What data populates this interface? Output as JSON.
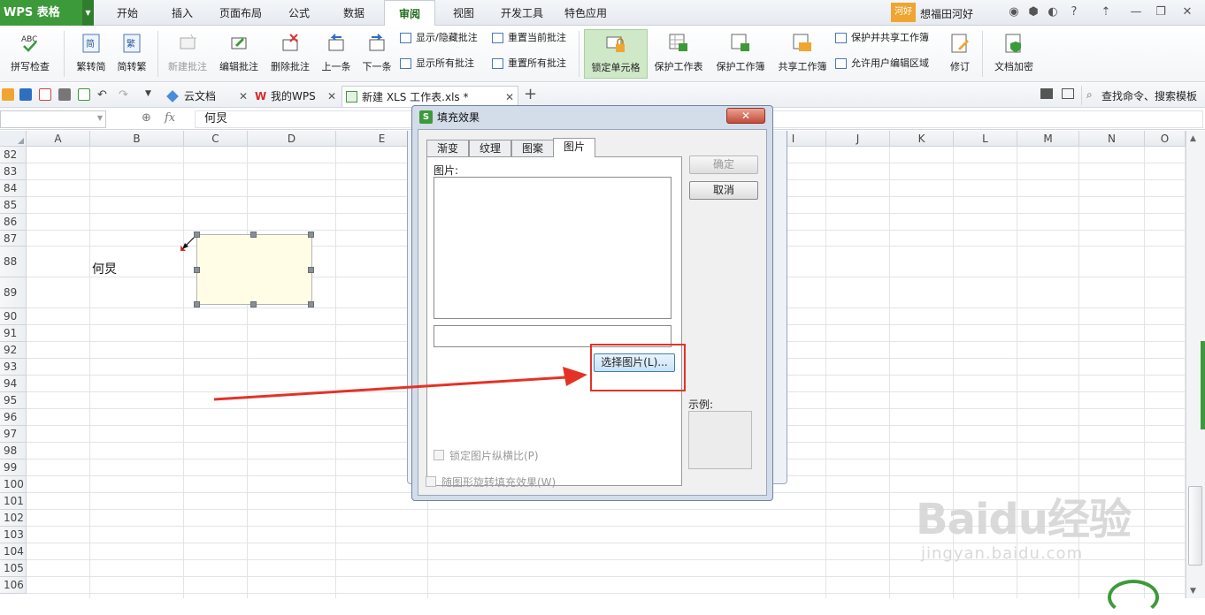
{
  "app": {
    "logo": "WPS 表格",
    "user_badge": "河好",
    "user_name": "想福田河好"
  },
  "menu": {
    "tabs": [
      "开始",
      "插入",
      "页面布局",
      "公式",
      "数据",
      "审阅",
      "视图",
      "开发工具",
      "特色应用"
    ],
    "active": "审阅"
  },
  "ribbon": {
    "spell_check": "拼写检查",
    "to_traditional": "繁转简",
    "to_simplified": "简转繁",
    "new_comment": "新建批注",
    "edit_comment": "编辑批注",
    "delete_comment": "删除批注",
    "prev": "上一条",
    "next": "下一条",
    "show_hide_comment": "显示/隐藏批注",
    "show_all_comments": "显示所有批注",
    "reset_current_comment": "重置当前批注",
    "reset_all_comments": "重置所有批注",
    "lock_cell": "锁定单元格",
    "protect_sheet": "保护工作表",
    "protect_workbook": "保护工作簿",
    "share_workbook": "共享工作簿",
    "protect_share_workbook": "保护并共享工作簿",
    "allow_edit_ranges": "允许用户编辑区域",
    "revise": "修订",
    "doc_encrypt": "文档加密"
  },
  "doc_tabs": {
    "cloud": "云文档",
    "my_wps": "我的WPS",
    "current": "新建 XLS 工作表.xls *",
    "search": "查找命令、搜索模板"
  },
  "formula": {
    "fx": "fx",
    "value": "何炅"
  },
  "sheet": {
    "columns": [
      "A",
      "B",
      "C",
      "D",
      "E",
      "I",
      "J",
      "K",
      "L",
      "M",
      "N",
      "O"
    ],
    "rows": [
      "82",
      "83",
      "84",
      "85",
      "86",
      "87",
      "88",
      "89",
      "90",
      "91",
      "92",
      "93",
      "94",
      "95",
      "96",
      "97",
      "98",
      "99",
      "100",
      "101",
      "102",
      "103",
      "104",
      "105",
      "106"
    ],
    "cell_b88": "何炅"
  },
  "dialog": {
    "title": "填充效果",
    "tabs": [
      "渐变",
      "纹理",
      "图案",
      "图片"
    ],
    "active_tab": "图片",
    "picture_label": "图片:",
    "select_picture": "选择图片(L)...",
    "lock_ratio": "锁定图片纵横比(P)",
    "rotate_with_shape": "随图形旋转填充效果(W)",
    "ok": "确定",
    "cancel": "取消",
    "sample": "示例:"
  },
  "watermark": {
    "brand": "Baidu经验",
    "url": "jingyan.baidu.com"
  },
  "colors": {
    "brand_green": "#3d9a3a",
    "annotation_red": "#e53226"
  }
}
